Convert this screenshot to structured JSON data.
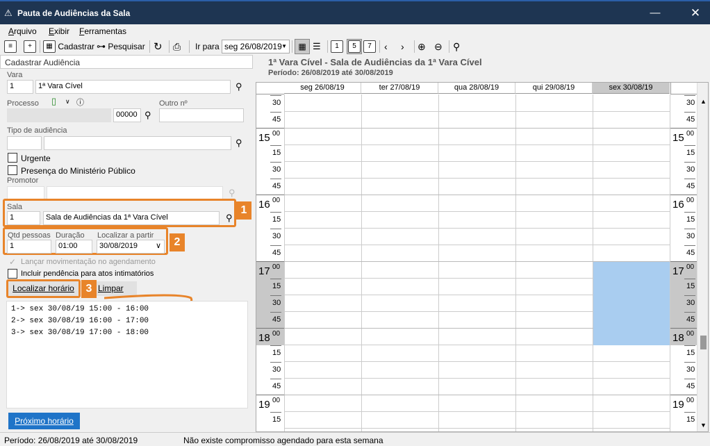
{
  "window": {
    "title": "Pauta de Audiências da Sala",
    "minimize": "—",
    "close": "✕"
  },
  "menu": [
    {
      "label": "Arquivo",
      "u": "A",
      "rest": "rquivo"
    },
    {
      "label": "Exibir",
      "u": "E",
      "rest": "xibir"
    },
    {
      "label": "Ferramentas",
      "u": "F",
      "rest": "erramentas"
    }
  ],
  "toolbar": {
    "cadastrar": "Cadastrar",
    "pesquisar": "Pesquisar",
    "ir_para": "Ir para",
    "date": "seg 26/08/2019"
  },
  "form": {
    "section_title": "Cadastrar Audiência",
    "vara_label": "Vara",
    "vara_code": "1",
    "vara_name": "1ª Vara Cível",
    "processo_label": "Processo",
    "processo_num": "00000",
    "outro_label": "Outro nº",
    "tipo_label": "Tipo de audiência",
    "urgente": "Urgente",
    "presenca": "Presença do Ministério Público",
    "promotor_label": "Promotor",
    "sala_label": "Sala",
    "sala_code": "1",
    "sala_name": "Sala de Audiências da 1ª Vara Cível",
    "qtd_label": "Qtd pessoas",
    "qtd_value": "1",
    "duracao_label": "Duração",
    "duracao_value": "01:00",
    "localizar_label": "Localizar a partir",
    "localizar_value": "30/08/2019",
    "lancar": "Lançar movimentação no agendamento",
    "incluir": "Incluir pendência para atos intimatórios",
    "localizar_btn": "Localizar horário",
    "limpar_btn": "Limpar",
    "results": [
      "1-> sex 30/08/19 15:00 - 16:00",
      "2-> sex 30/08/19 16:00 - 17:00",
      "3-> sex 30/08/19 17:00 - 18:00"
    ],
    "proximo_btn": "Próximo horário"
  },
  "badges": [
    "1",
    "2",
    "3"
  ],
  "calendar": {
    "title": "1ª Vara Cível - Sala de Audiências da 1ª Vara Cível",
    "subtitle": "Período: 26/08/2019 até 30/08/2019",
    "days": [
      "seg 26/08/19",
      "ter 27/08/19",
      "qua 28/08/19",
      "qui 29/08/19",
      "sex 30/08/19"
    ],
    "selected_day": "sex 30/08/19",
    "slots": [
      {
        "h": "",
        "m": "30"
      },
      {
        "h": "",
        "m": "45"
      },
      {
        "h": "15",
        "m": "00"
      },
      {
        "h": "",
        "m": "15"
      },
      {
        "h": "",
        "m": "30"
      },
      {
        "h": "",
        "m": "45"
      },
      {
        "h": "16",
        "m": "00"
      },
      {
        "h": "",
        "m": "15"
      },
      {
        "h": "",
        "m": "30"
      },
      {
        "h": "",
        "m": "45"
      },
      {
        "h": "17",
        "m": "00"
      },
      {
        "h": "",
        "m": "15"
      },
      {
        "h": "",
        "m": "30"
      },
      {
        "h": "",
        "m": "45"
      },
      {
        "h": "18",
        "m": "00"
      },
      {
        "h": "",
        "m": "15"
      },
      {
        "h": "",
        "m": "30"
      },
      {
        "h": "",
        "m": "45"
      },
      {
        "h": "19",
        "m": "00"
      },
      {
        "h": "",
        "m": "15"
      }
    ],
    "highlight_color": "#a9cdf0"
  },
  "status": {
    "periodo": "Período: 26/08/2019 até 30/08/2019",
    "mensagem": "Não existe compromisso agendado para esta semana"
  },
  "colors": {
    "accent": "#e8842a",
    "titlebar": "#1e3552",
    "button_blue": "#1f74c8"
  }
}
